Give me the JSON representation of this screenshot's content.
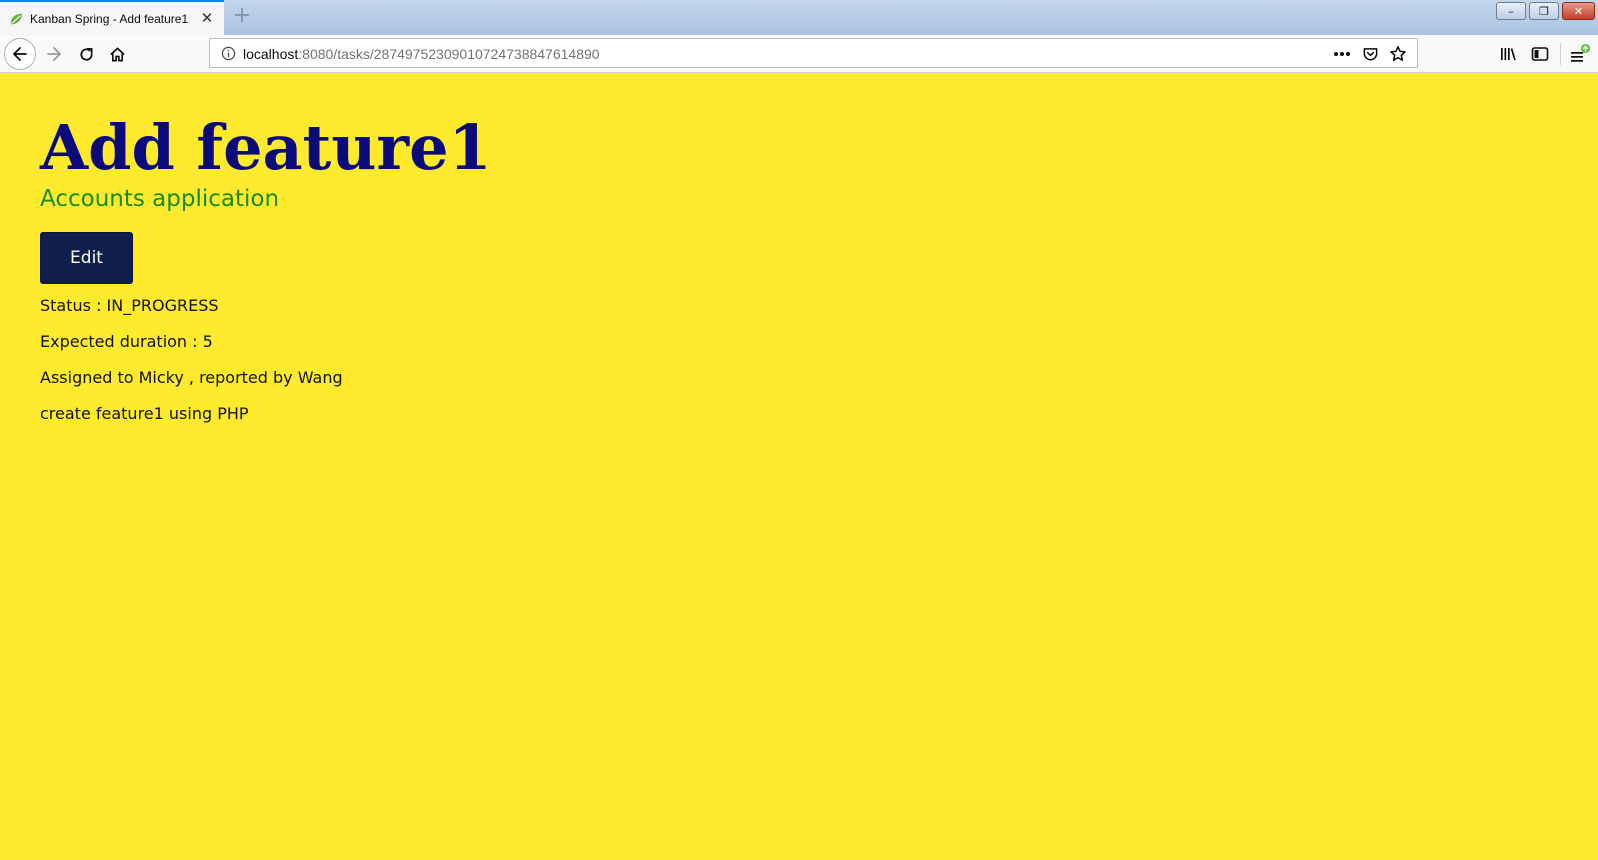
{
  "browser": {
    "tab_title": "Kanban Spring - Add feature1",
    "tab_close": "✕",
    "new_tab": "+",
    "url_host": "localhost",
    "url_rest": ":8080/tasks/28749752309010724738847614890",
    "window_controls": {
      "minimize": "–",
      "restore": "❐",
      "close": "✕"
    }
  },
  "task": {
    "title": "Add feature1",
    "project": "Accounts application",
    "edit_label": "Edit",
    "status_line": "Status : IN_PROGRESS",
    "duration_line": "Expected duration : 5",
    "assignment_line": "Assigned to Micky , reported by Wang",
    "description": "create feature1 using PHP"
  },
  "colors": {
    "page_background": "#ffea2e",
    "title": "#0a0a7a",
    "project": "#188a18",
    "edit_button": "#0f1e4c"
  },
  "icons": [
    "spring-leaf-icon",
    "close-icon",
    "plus-icon",
    "back-arrow-icon",
    "forward-arrow-icon",
    "reload-icon",
    "home-icon",
    "info-icon",
    "more-dots-icon",
    "pocket-icon",
    "star-icon",
    "library-icon",
    "sidebar-icon",
    "menu-icon"
  ]
}
